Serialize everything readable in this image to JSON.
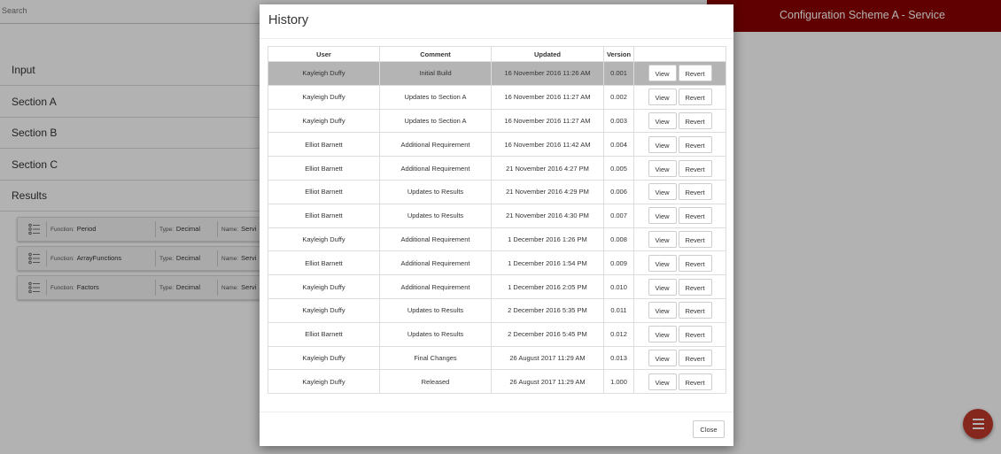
{
  "search": {
    "placeholder": "Search"
  },
  "header": {
    "title": "Configuration Scheme A - Service"
  },
  "sections": [
    "Input",
    "Section A",
    "Section B",
    "Section C",
    "Results"
  ],
  "functions": {
    "function_key": "Function:",
    "type_key": "Type:",
    "name_key": "Name:",
    "items": [
      {
        "function": "Period",
        "type": "Decimal",
        "name": "Servi"
      },
      {
        "function": "ArrayFunctions",
        "type": "Decimal",
        "name": "Servi"
      },
      {
        "function": "Factors",
        "type": "Decimal",
        "name": "Servi"
      }
    ]
  },
  "modal": {
    "title": "History",
    "columns": {
      "user": "User",
      "comment": "Comment",
      "updated": "Updated",
      "version": "Version",
      "actions": ""
    },
    "view_label": "View",
    "revert_label": "Revert",
    "close_label": "Close",
    "selected_row": 0,
    "rows": [
      {
        "user": "Kayleigh Duffy",
        "comment": "Initial Build",
        "updated": "16 November 2016 11:26 AM",
        "version": "0.001"
      },
      {
        "user": "Kayleigh Duffy",
        "comment": "Updates to Section A",
        "updated": "16 November 2016 11:27 AM",
        "version": "0.002"
      },
      {
        "user": "Kayleigh Duffy",
        "comment": "Updates to Section A",
        "updated": "16 November 2016 11:27 AM",
        "version": "0.003"
      },
      {
        "user": "Elliot Barnett",
        "comment": "Additional Requirement",
        "updated": "16 November 2016 11:42 AM",
        "version": "0.004"
      },
      {
        "user": "Elliot Barnett",
        "comment": "Additional Requirement",
        "updated": "21 November 2016 4:27 PM",
        "version": "0.005"
      },
      {
        "user": "Elliot Barnett",
        "comment": "Updates to Results",
        "updated": "21 November 2016 4:29 PM",
        "version": "0.006"
      },
      {
        "user": "Elliot Barnett",
        "comment": "Updates to Results",
        "updated": "21 November 2016 4:30 PM",
        "version": "0.007"
      },
      {
        "user": "Kayleigh Duffy",
        "comment": "Additional Requirement",
        "updated": "1 December 2016 1:26 PM",
        "version": "0.008"
      },
      {
        "user": "Elliot Barnett",
        "comment": "Additional Requirement",
        "updated": "1 December 2016 1:54 PM",
        "version": "0.009"
      },
      {
        "user": "Kayleigh Duffy",
        "comment": "Additional Requirement",
        "updated": "1 December 2016 2:05 PM",
        "version": "0.010"
      },
      {
        "user": "Kayleigh Duffy",
        "comment": "Updates to Results",
        "updated": "2 December 2016 5:35 PM",
        "version": "0.011"
      },
      {
        "user": "Elliot Barnett",
        "comment": "Updates to Results",
        "updated": "2 December 2016 5:45 PM",
        "version": "0.012"
      },
      {
        "user": "Kayleigh Duffy",
        "comment": "Final Changes",
        "updated": "26 August 2017 11:29 AM",
        "version": "0.013"
      },
      {
        "user": "Kayleigh Duffy",
        "comment": "Released",
        "updated": "26 August 2017 11:29 AM",
        "version": "1.000"
      }
    ]
  },
  "colors": {
    "header_bg": "#8b0000",
    "fab_bg": "#c0392b",
    "selected_row_bg": "#b4b4b4"
  },
  "icons": {
    "function_card": "list-icon",
    "fab": "menu-icon"
  }
}
